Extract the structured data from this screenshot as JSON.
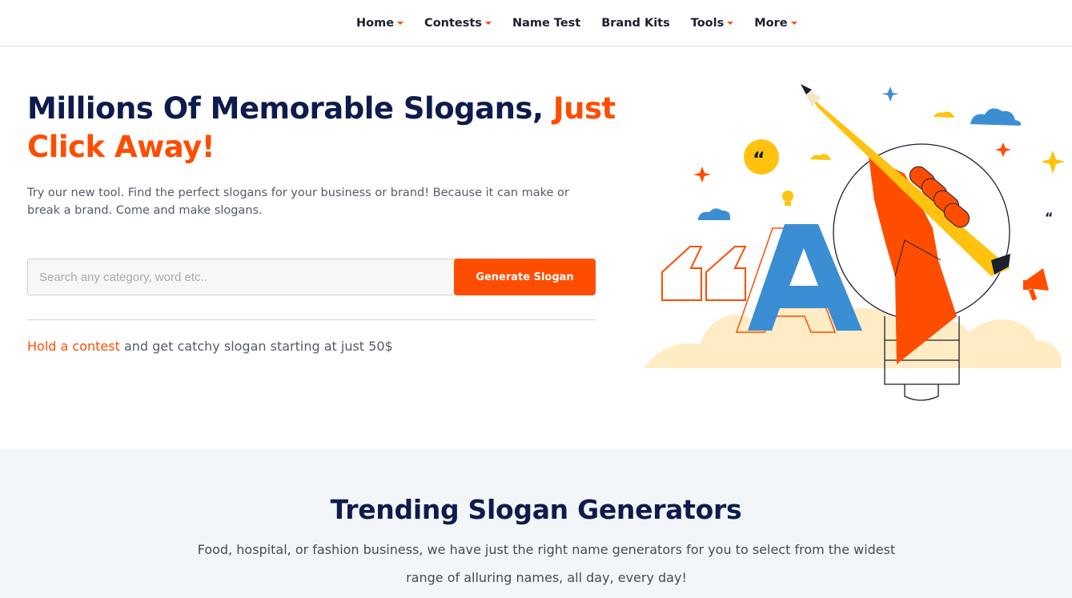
{
  "nav": {
    "items": [
      {
        "label": "Home",
        "has_dropdown": true
      },
      {
        "label": "Contests",
        "has_dropdown": true
      },
      {
        "label": "Name Test",
        "has_dropdown": false
      },
      {
        "label": "Brand Kits",
        "has_dropdown": false
      },
      {
        "label": "Tools",
        "has_dropdown": true
      },
      {
        "label": "More",
        "has_dropdown": true
      }
    ]
  },
  "hero": {
    "title_main": "Millions Of Memorable Slogans, ",
    "title_accent": "Just Click Away!",
    "description": "Try our new tool. Find the perfect slogans for your business or brand! Because it can make or break a brand. Come and make slogans.",
    "search_placeholder": "Search any category, word etc..",
    "search_value": "",
    "button_label": "Generate Slogan",
    "contest_link": "Hold a contest",
    "contest_rest": " and get catchy slogan starting at just 50$"
  },
  "illustration": {
    "icons": [
      "pencil-icon",
      "light-bulb-icon",
      "hand-icon",
      "letter-a-icon",
      "quote-mark-icon",
      "megaphone-icon",
      "cloud-icon",
      "sparkle-icon"
    ],
    "letter": "A"
  },
  "trending": {
    "title": "Trending Slogan Generators",
    "description": "Food, hospital, or fashion business, we have just the right name generators for you to select from the widest range of alluring names, all day, every day!"
  },
  "colors": {
    "accent": "#ff4d00",
    "navy": "#0e1b4d",
    "blue": "#3b8ed3",
    "yellow": "#ffc20e",
    "section_bg": "#f3f6f9"
  }
}
